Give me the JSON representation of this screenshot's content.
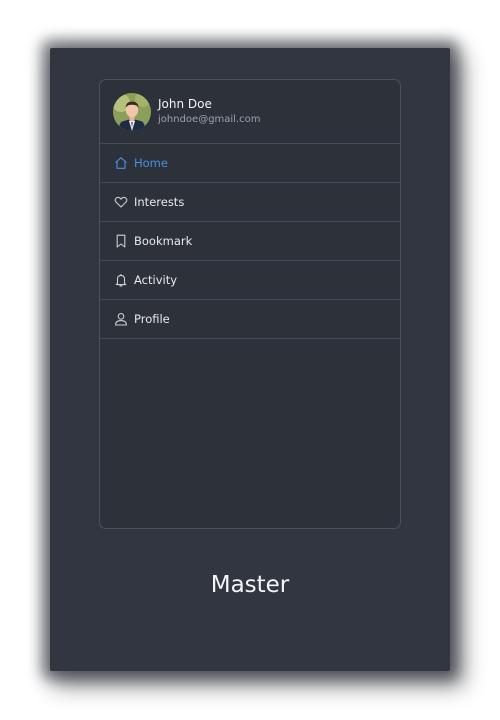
{
  "user": {
    "name": "John Doe",
    "email": "johndoe@gmail.com"
  },
  "nav": {
    "items": [
      {
        "label": "Home",
        "icon": "home-icon",
        "active": true
      },
      {
        "label": "Interests",
        "icon": "heart-icon",
        "active": false
      },
      {
        "label": "Bookmark",
        "icon": "bookmark-icon",
        "active": false
      },
      {
        "label": "Activity",
        "icon": "bell-icon",
        "active": false
      },
      {
        "label": "Profile",
        "icon": "user-icon",
        "active": false
      }
    ]
  },
  "caption": "Master",
  "colors": {
    "card_background": "#313640",
    "panel_background": "#2d3139",
    "accent": "#4a90e2",
    "text": "#e8eaee",
    "muted_text": "#9aa1ad"
  }
}
